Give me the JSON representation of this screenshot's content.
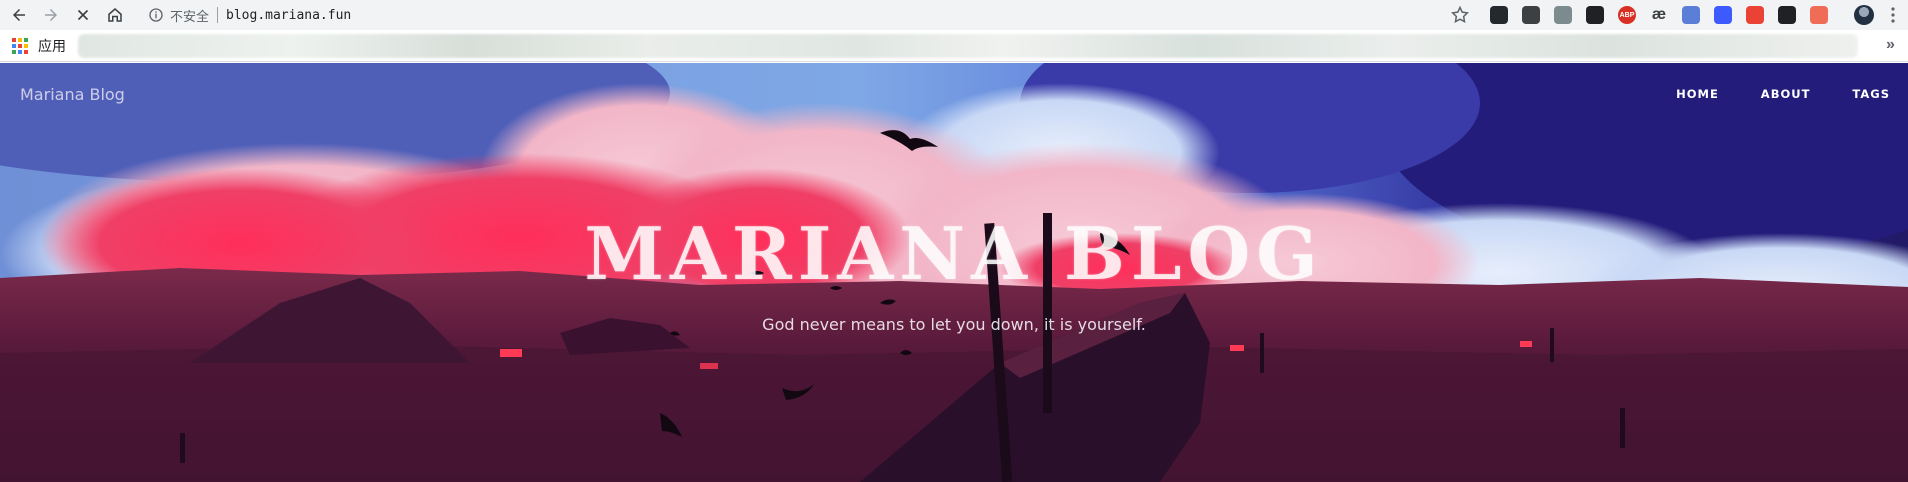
{
  "browser": {
    "security_label": "不安全",
    "url": "blog.mariana.fun",
    "bookmarks": {
      "apps_label": "应用"
    },
    "extensions": [
      {
        "name": "ext-github-icon",
        "text": "",
        "color": "#24292e"
      },
      {
        "name": "ext-square-icon",
        "text": "",
        "color": "#3c4043"
      },
      {
        "name": "ext-vue-icon",
        "text": "",
        "color": "#7b8b8e"
      },
      {
        "name": "ext-bitwarden-icon",
        "text": "",
        "color": "#202124"
      },
      {
        "name": "ext-adblock-icon",
        "text": "ABP",
        "color": "#d93025"
      },
      {
        "name": "ext-ae-icon",
        "text": "æ",
        "color": "#3c4043"
      },
      {
        "name": "ext-circle-icon",
        "text": "",
        "color": "#5b7fd6"
      },
      {
        "name": "ext-pocket-icon",
        "text": "",
        "color": "#3d5afe"
      },
      {
        "name": "ext-map-pin-icon",
        "text": "",
        "color": "#ea4335"
      },
      {
        "name": "ext-bird-icon",
        "text": "",
        "color": "#202124"
      },
      {
        "name": "ext-gear-icon",
        "text": "",
        "color": "#ef6c57"
      }
    ]
  },
  "site": {
    "brand": "Mariana Blog",
    "nav": [
      "HOME",
      "ABOUT",
      "TAGS"
    ],
    "title": "MARIANA BLOG",
    "subtitle": "God never means to let you down, it is yourself."
  }
}
